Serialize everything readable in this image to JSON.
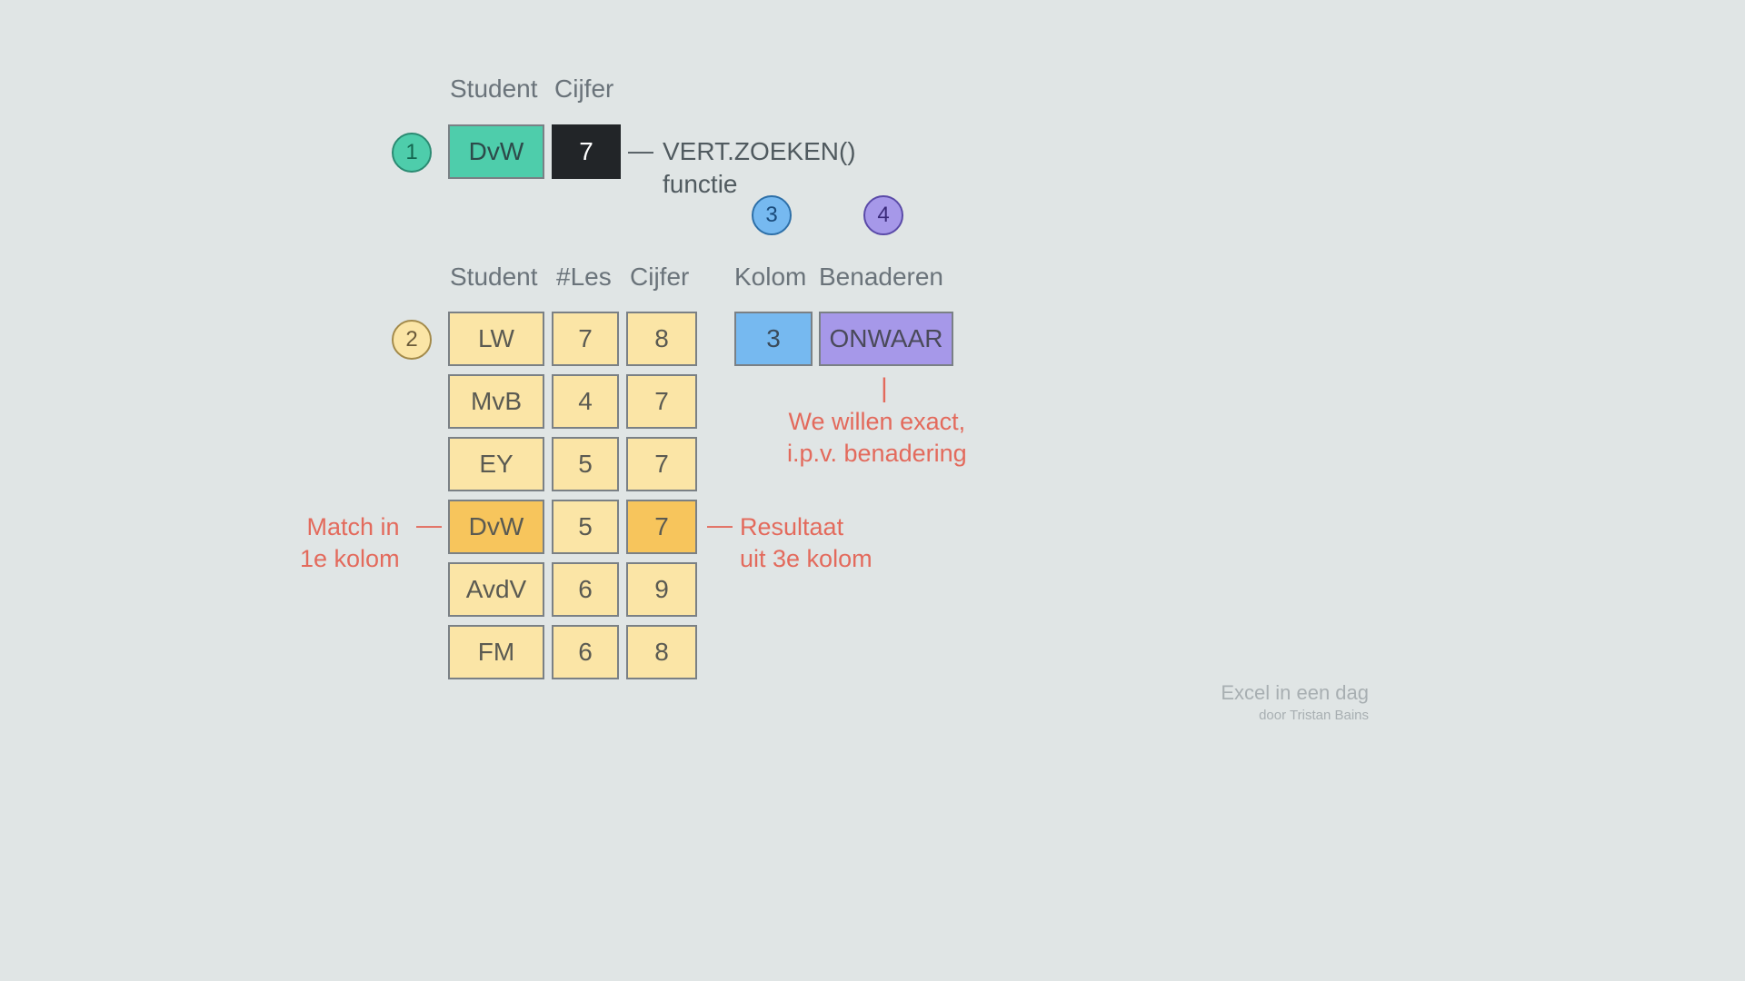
{
  "top": {
    "headers": [
      "Student",
      "Cijfer"
    ],
    "student_value": "DvW",
    "grade_value": "7",
    "func_line1": "VERT.ZOEKEN()",
    "func_line2": "functie"
  },
  "steps": {
    "s1": "1",
    "s2": "2",
    "s3": "3",
    "s4": "4"
  },
  "table": {
    "headers": [
      "Student",
      "#Les",
      "Cijfer"
    ],
    "rows": [
      {
        "student": "LW",
        "les": "7",
        "grade": "8",
        "hl": false
      },
      {
        "student": "MvB",
        "les": "4",
        "grade": "7",
        "hl": false
      },
      {
        "student": "EY",
        "les": "5",
        "grade": "7",
        "hl": false
      },
      {
        "student": "DvW",
        "les": "5",
        "grade": "7",
        "hl": true
      },
      {
        "student": "AvdV",
        "les": "6",
        "grade": "9",
        "hl": false
      },
      {
        "student": "FM",
        "les": "6",
        "grade": "8",
        "hl": false
      }
    ]
  },
  "right": {
    "headers": [
      "Kolom",
      "Benaderen"
    ],
    "kolom_value": "3",
    "benaderen_value": "ONWAAR",
    "note_l1": "We willen exact,",
    "note_l2": "i.p.v. benadering"
  },
  "left_note": {
    "l1": "Match in",
    "l2": "1e kolom"
  },
  "result_note": {
    "l1": "Resultaat",
    "l2": "uit 3e kolom"
  },
  "dash": "—",
  "pipe": "|",
  "footer": {
    "title": "Excel in een dag",
    "author": "door Tristan Bains"
  }
}
